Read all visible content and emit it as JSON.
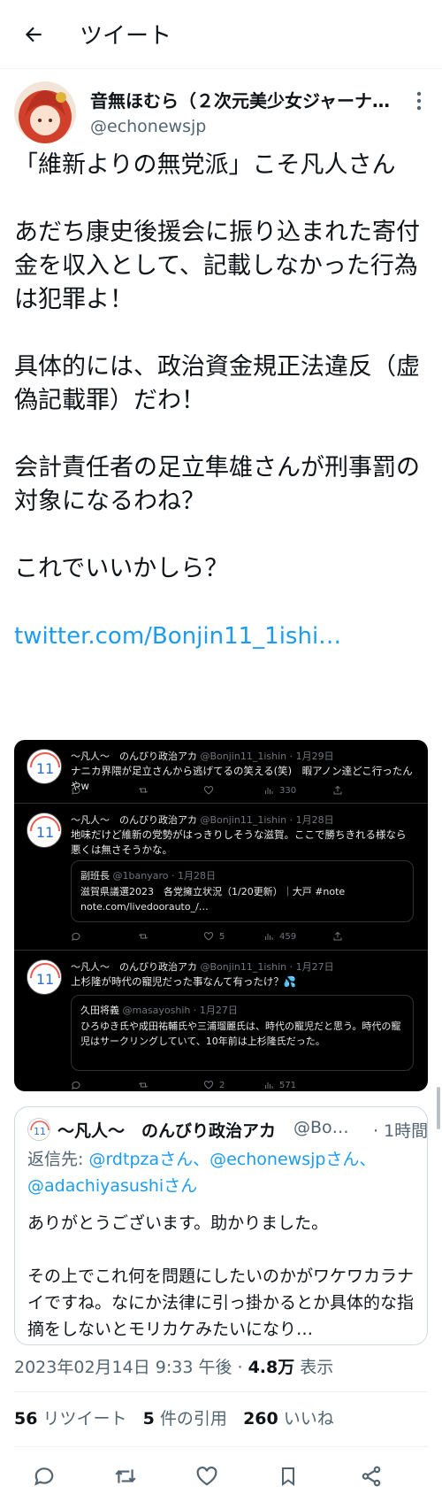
{
  "header": {
    "title": "ツイート"
  },
  "author": {
    "name": "音無ほむら（２次元美少女ジャーナ…",
    "handle": "@echonewsjp"
  },
  "tweet": {
    "paragraphs": [
      "「維新よりの無党派」こそ凡人さん",
      "あだち康史後援会に振り込まれた寄付金を収入として、記載しなかった行為は犯罪よ！",
      "具体的には、政治資金規正法違反（虚偽記載罪）だわ！",
      "会計責任者の足立隼雄さんが刑事罰の対象になるわね？",
      "これでいいかしら？"
    ],
    "link": "twitter.com/Bonjin11_1ishi…"
  },
  "embed": {
    "tweets": [
      {
        "name": "〜凡人〜　のんびり政治アカ",
        "handle": "@Bonjin11_1ishin · 1月29日",
        "text": "ナニカ界隈が足立さんから逃げてるの笑える(笑)　暇アノン達どこ行ったんやw",
        "stats": {
          "reply": "",
          "retweet": "",
          "like": "",
          "views": "330"
        }
      },
      {
        "name": "〜凡人〜　のんびり政治アカ",
        "handle": "@Bonjin11_1ishin · 1月28日",
        "text": "地味だけど維新の党勢がはっきりしそうな滋賀。ここで勝ちきれる様なら悪くは無さそうかな。",
        "quote": {
          "name": "副班長",
          "handle": "@1banyaro · 1月28日",
          "text": "滋賀県議選2023　各党擁立状況（1/20更新）｜大戸 #note note.com/livedoorauto_/…"
        },
        "stats": {
          "reply": "",
          "retweet": "",
          "like": "5",
          "views": "459"
        }
      },
      {
        "name": "〜凡人〜　のんびり政治アカ",
        "handle": "@Bonjin11_1ishin · 1月27日",
        "text": "上杉隆が時代の寵児だった事なんて有ったけ？💦",
        "quote": {
          "name": "久田将義",
          "handle": "@masayoshih · 1月27日",
          "text": "ひろゆき氏や成田祐輔氏や三浦瑠麗氏は、時代の寵児だと思う。時代の寵児はサークリングしていて、10年前は上杉隆氏だった。"
        },
        "stats": {
          "reply": "",
          "retweet": "",
          "like": "2",
          "views": "571"
        }
      }
    ]
  },
  "reply_card": {
    "name": "〜凡人〜　のんびり政治アカ",
    "handle": "@Bo…",
    "time": "· 1時間",
    "reply_to_label": "返信先:",
    "reply_to_users": "@rdtpzaさん、@echonewsjpさん、@adachiyasushiさん",
    "text_1": "ありがとうございます。助かりました。",
    "text_2": "その上でこれ何を問題にしたいのかがワケワカラナイですね。なにか法律に引っ掛かるとか具体的な指摘をしないとモリカケみたいになり…"
  },
  "meta": {
    "datetime": "2023年02月14日 9:33 午後",
    "views_count": "4.8万",
    "views_label": "表示"
  },
  "stats": {
    "retweets_count": "56",
    "retweets_label": "リツイート",
    "quotes_count": "5",
    "quotes_label": "件の引用",
    "likes_count": "260",
    "likes_label": "いいね"
  },
  "colors": {
    "accent": "#1d9bf0",
    "text": "#0f1419",
    "muted": "#536471",
    "embed_bg": "#000000"
  },
  "icons": [
    "back-arrow-icon",
    "more-icon",
    "reply-icon",
    "retweet-icon",
    "like-icon",
    "bookmark-icon",
    "share-icon",
    "views-icon"
  ]
}
